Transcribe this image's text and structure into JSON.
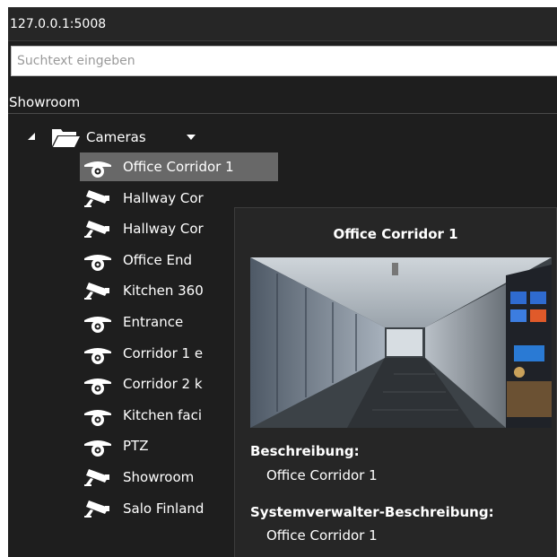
{
  "address_bar": {
    "text": "127.0.0.1:5008"
  },
  "search": {
    "placeholder": "Suchtext eingeben",
    "value": ""
  },
  "site": {
    "label": "Showroom"
  },
  "tree": {
    "folder": {
      "label": "Cameras",
      "expanded": true,
      "icon": "folder-open-icon"
    },
    "cameras": [
      {
        "label": "Office Corridor 1",
        "icon": "dome-camera-icon",
        "selected": true
      },
      {
        "label": "Hallway Cor",
        "icon": "ptz-camera-icon",
        "selected": false
      },
      {
        "label": "Hallway Cor",
        "icon": "ptz-camera-icon",
        "selected": false
      },
      {
        "label": "Office End",
        "icon": "dome-camera-icon",
        "selected": false
      },
      {
        "label": "Kitchen 360",
        "icon": "ptz-camera-icon",
        "selected": false
      },
      {
        "label": "Entrance",
        "icon": "dome-camera-icon",
        "selected": false
      },
      {
        "label": "Corridor 1 e",
        "icon": "dome-camera-icon",
        "selected": false
      },
      {
        "label": "Corridor 2 k",
        "icon": "dome-camera-icon",
        "selected": false
      },
      {
        "label": "Kitchen faci",
        "icon": "dome-camera-icon",
        "selected": false
      },
      {
        "label": "PTZ",
        "icon": "dome-camera-icon",
        "selected": false
      },
      {
        "label": "Showroom",
        "icon": "ptz-camera-icon",
        "selected": false
      },
      {
        "label": "Salo Finland",
        "icon": "ptz-camera-icon",
        "selected": false
      }
    ]
  },
  "tooltip": {
    "title": "Office Corridor 1",
    "description_heading": "Beschreibung:",
    "description_value": "Office Corridor 1",
    "admin_description_heading": "Systemverwalter-Beschreibung:",
    "admin_description_value": "Office Corridor 1"
  },
  "colors": {
    "panel_bg": "#1e1e1e",
    "selection_bg": "#686868",
    "tooltip_bg": "#262626",
    "text": "#ffffff"
  }
}
